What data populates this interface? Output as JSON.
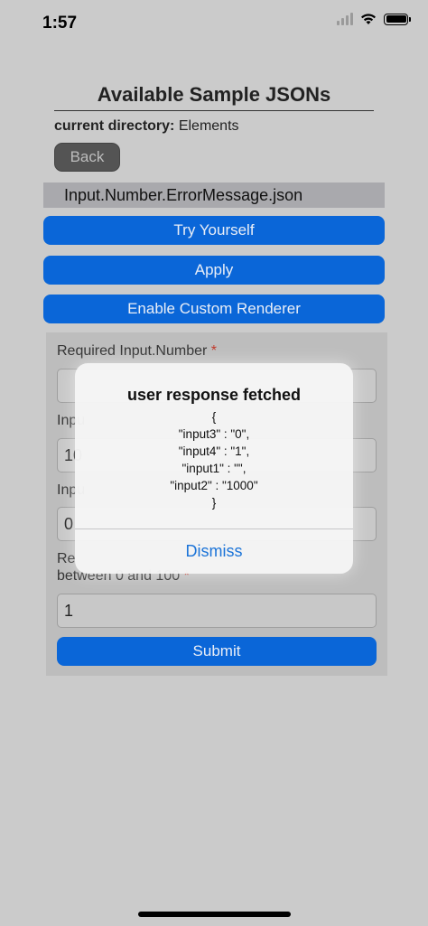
{
  "status": {
    "time": "1:57"
  },
  "header": {
    "title": "Available Sample JSONs",
    "dir_label": "current directory:",
    "dir_value": "Elements",
    "back_label": "Back",
    "file_name": "Input.Number.ErrorMessage.json"
  },
  "actions": {
    "try_label": "Try Yourself",
    "apply_label": "Apply",
    "custom_renderer_label": "Enable Custom Renderer"
  },
  "form": {
    "field1_label": "Required Input.Number",
    "field1_req": "*",
    "field1_value": "",
    "field2_label": "Inpu",
    "field2_value": "10",
    "field3_label": "Inpu",
    "field3_value": "0",
    "field4_label_line1": "Re",
    "field4_label_line2": "between 0 and 100",
    "field4_req": "*",
    "field4_value": "1",
    "submit_label": "Submit"
  },
  "alert": {
    "title": "user response fetched",
    "lines": [
      "{",
      "\"input3\" : \"0\",",
      "\"input4\" : \"1\",",
      "\"input1\" : \"\",",
      "\"input2\" : \"1000\"",
      "}"
    ],
    "dismiss_label": "Dismiss"
  },
  "colors": {
    "accent": "#0a66d8",
    "required": "#c0392b",
    "dismiss": "#1c74d8"
  }
}
